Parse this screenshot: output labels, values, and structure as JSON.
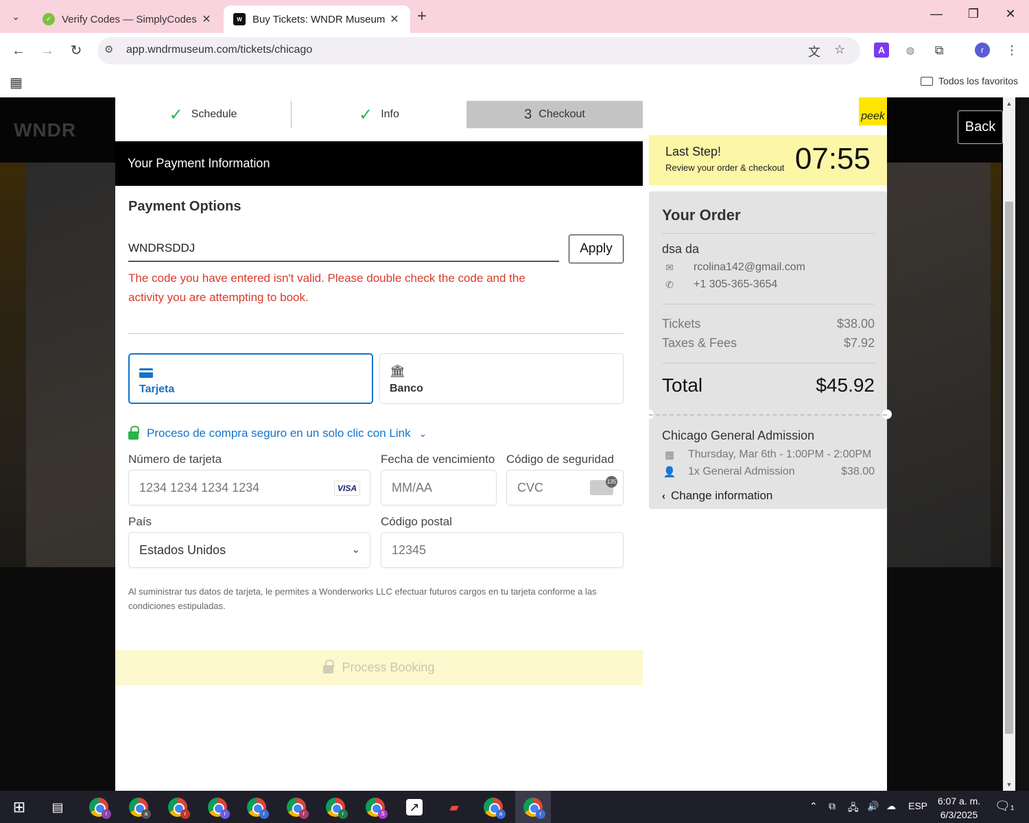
{
  "browser": {
    "tabs": [
      {
        "title": "Verify Codes — SimplyCodes",
        "favicon": "simplycodes-icon",
        "active": false
      },
      {
        "title": "Buy Tickets: WNDR Museum Ch",
        "favicon": "wndr-icon",
        "active": true
      }
    ],
    "url": "app.wndrmuseum.com/tickets/chicago",
    "bookmarks_label": "Todos los favoritos"
  },
  "page": {
    "bg_logo": "WNDR",
    "back_label": "Back",
    "steps": [
      {
        "num": "",
        "label": "Schedule",
        "done": true
      },
      {
        "num": "",
        "label": "Info",
        "done": true
      },
      {
        "num": "3",
        "label": "Checkout",
        "done": false
      }
    ],
    "peek_logo": "peek",
    "payment_header": "Your Payment Information",
    "payment_options_title": "Payment Options",
    "promo_code_value": "WNDRSDDJ",
    "apply_label": "Apply",
    "error_message": "The code you have entered isn't valid. Please double check the code and the activity you are attempting to book.",
    "methods": [
      {
        "label": "Tarjeta",
        "icon": "credit-card-icon",
        "selected": true
      },
      {
        "label": "Banco",
        "icon": "bank-icon",
        "selected": false
      }
    ],
    "link_text": "Proceso de compra seguro en un solo clic con Link",
    "card_number_label": "Número de tarjeta",
    "card_number_placeholder": "1234 1234 1234 1234",
    "card_brand": "VISA",
    "expiry_label": "Fecha de vencimiento",
    "expiry_placeholder": "MM/AA",
    "cvc_label": "Código de seguridad",
    "cvc_placeholder": "CVC",
    "cvc_badge": "135",
    "country_label": "País",
    "country_value": "Estados Unidos",
    "postal_label": "Código postal",
    "postal_placeholder": "12345",
    "disclaimer": "Al suministrar tus datos de tarjeta, le permites a Wonderworks LLC efectuar futuros cargos en tu tarjeta conforme a las condiciones estipuladas.",
    "process_label": "Process Booking"
  },
  "sidebar": {
    "timer_title": "Last Step!",
    "timer_subtitle": "Review your order & checkout",
    "timer_value": "07:55",
    "order_title": "Your Order",
    "customer_name": "dsa da",
    "email": "rcolina142@gmail.com",
    "phone": "+1 305-365-3654",
    "tickets_label": "Tickets",
    "tickets_value": "$38.00",
    "fees_label": "Taxes & Fees",
    "fees_value": "$7.92",
    "total_label": "Total",
    "total_value": "$45.92",
    "event_name": "Chicago General Admission",
    "event_date": "Thursday, Mar 6th - 1:00PM - 2:00PM",
    "ticket_line": "1x General Admission",
    "ticket_line_price": "$38.00",
    "change_label": "Change information"
  },
  "taskbar": {
    "language": "ESP",
    "time": "6:07 a. m.",
    "date": "6/3/2025",
    "notification_count": "1"
  },
  "colors": {
    "accent_blue": "#1473c9",
    "error_red": "#d93a2b",
    "check_green": "#2cb34a",
    "timer_yellow": "#fcf6a7",
    "tab_bar_pink": "#f9d3dd"
  }
}
